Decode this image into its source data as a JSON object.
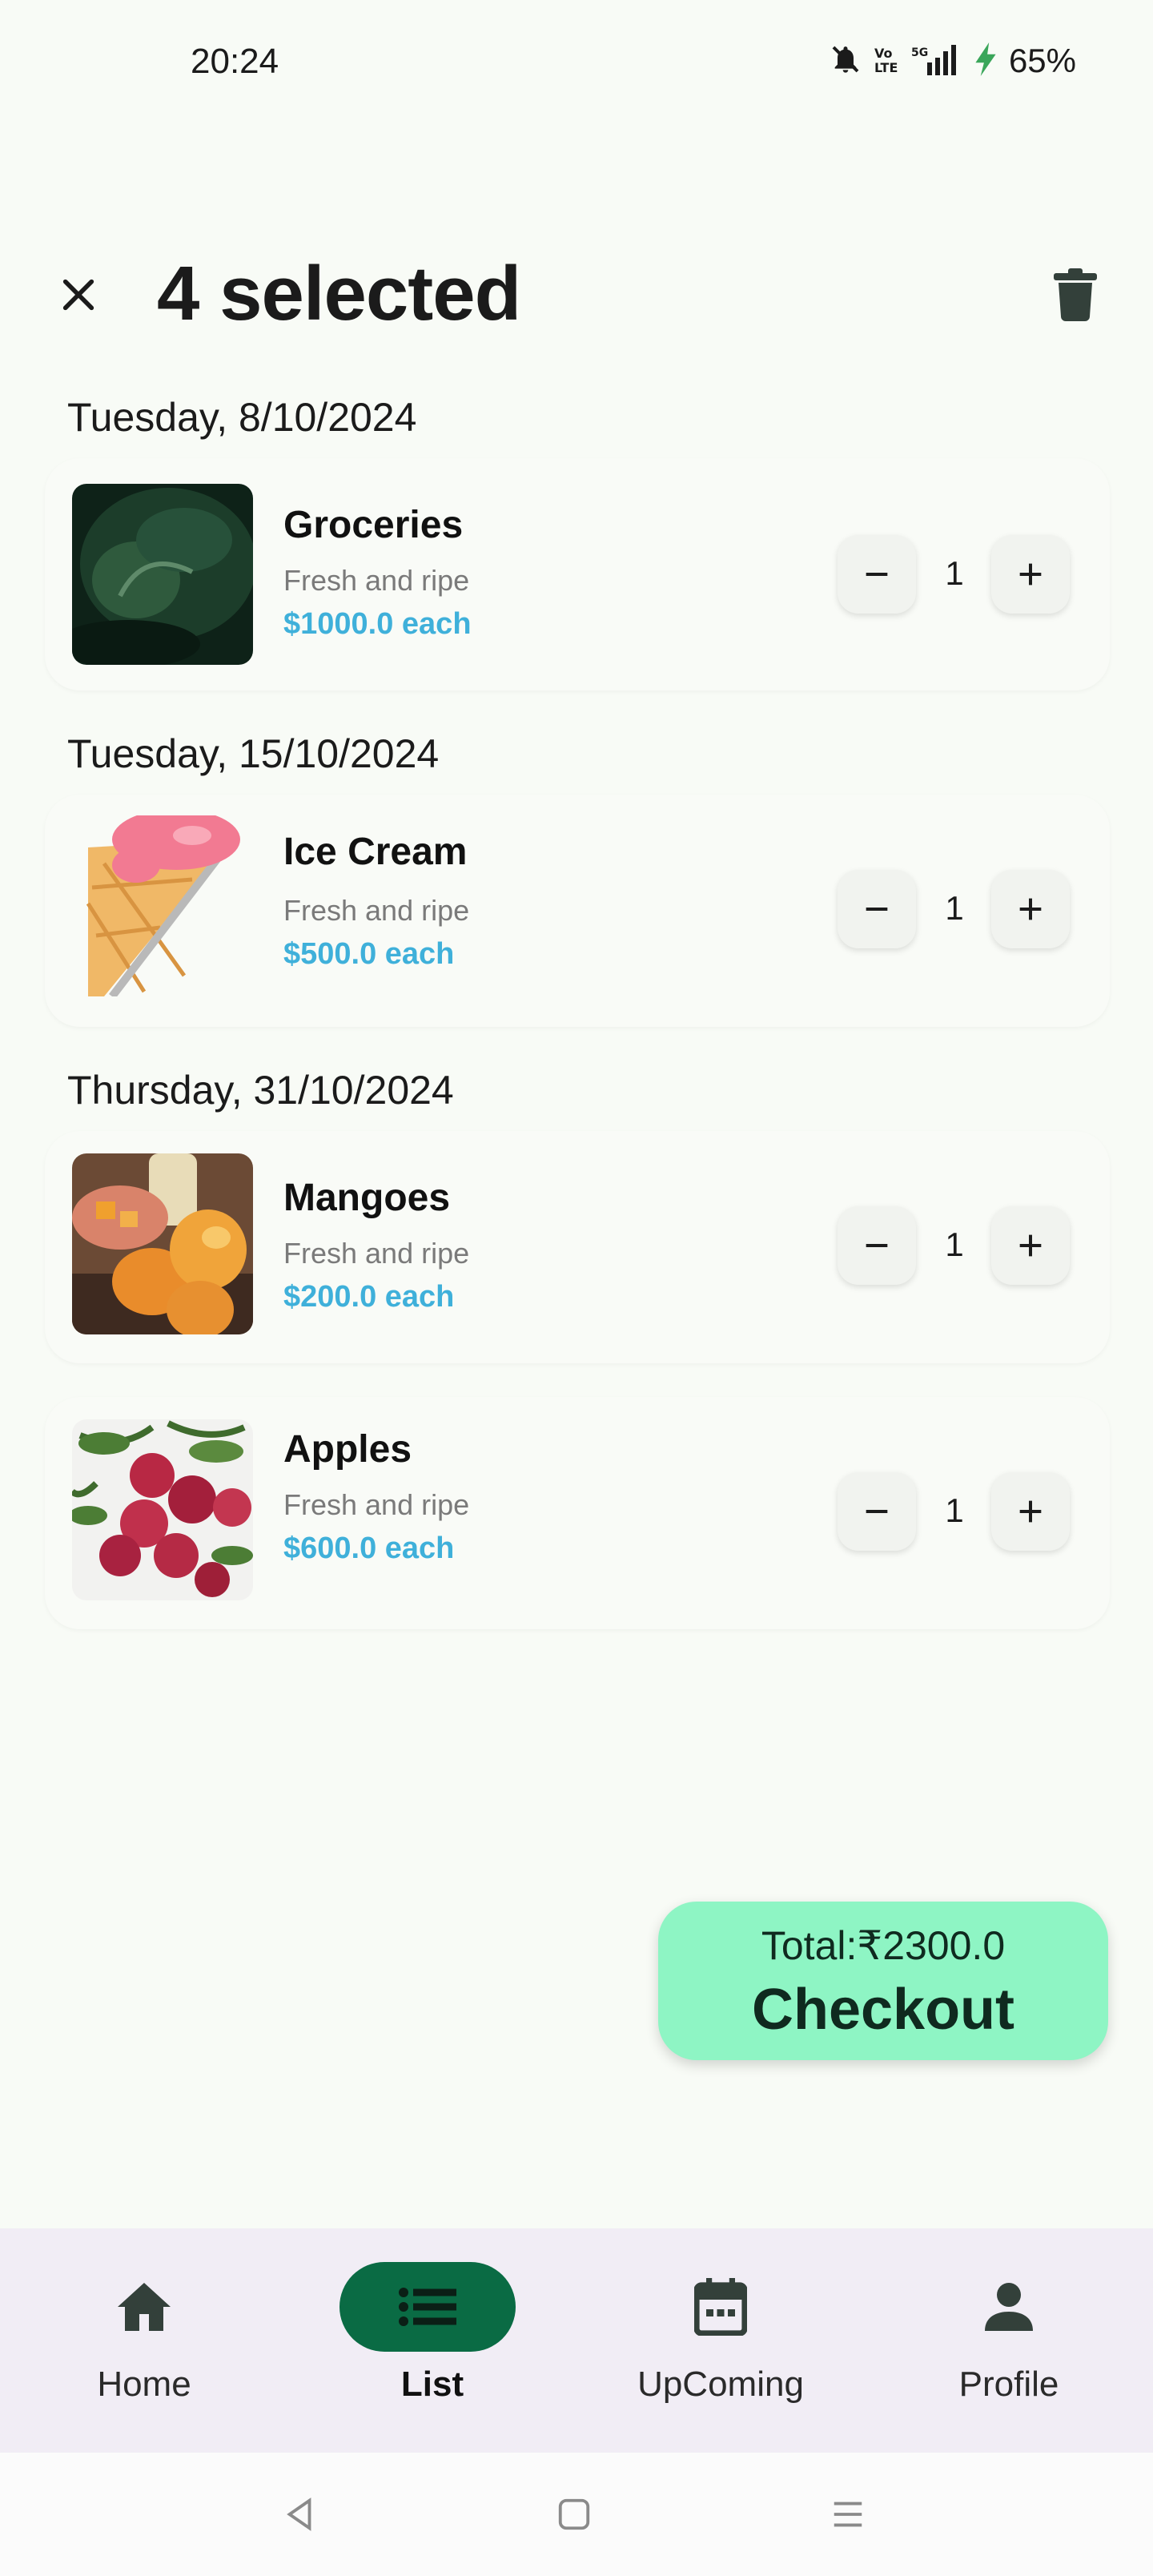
{
  "status_bar": {
    "time": "20:24",
    "battery": "65%",
    "icons": [
      "bell-off-icon",
      "volte-icon",
      "5g-signal-icon",
      "charging-icon"
    ]
  },
  "header": {
    "title": "4 selected",
    "close_icon": "close-icon",
    "delete_icon": "trash-icon"
  },
  "groups": [
    {
      "date": "Tuesday, 8/10/2024",
      "items": [
        {
          "name": "Groceries",
          "desc": "Fresh and ripe",
          "price": "$1000.0 each",
          "qty": "1"
        }
      ]
    },
    {
      "date": "Tuesday, 15/10/2024",
      "items": [
        {
          "name": "Ice Cream",
          "desc": "Fresh and ripe",
          "price": "$500.0 each",
          "qty": "1"
        }
      ]
    },
    {
      "date": "Thursday, 31/10/2024",
      "items": [
        {
          "name": "Mangoes",
          "desc": "Fresh and ripe",
          "price": "$200.0 each",
          "qty": "1"
        },
        {
          "name": "Apples",
          "desc": "Fresh and ripe",
          "price": "$600.0 each",
          "qty": "1"
        }
      ]
    }
  ],
  "checkout": {
    "total": "Total:₹2300.0",
    "label": "Checkout"
  },
  "nav": {
    "items": [
      {
        "label": "Home",
        "icon": "home-icon",
        "active": false
      },
      {
        "label": "List",
        "icon": "list-icon",
        "active": true
      },
      {
        "label": "UpComing",
        "icon": "calendar-icon",
        "active": false
      },
      {
        "label": "Profile",
        "icon": "person-icon",
        "active": false
      }
    ]
  },
  "colors": {
    "accent": "#0a6b44",
    "checkout_bg": "#8ef5c4",
    "price": "#3fb0da",
    "background": "#f8fbf6",
    "nav_bg": "#f1edf5"
  }
}
